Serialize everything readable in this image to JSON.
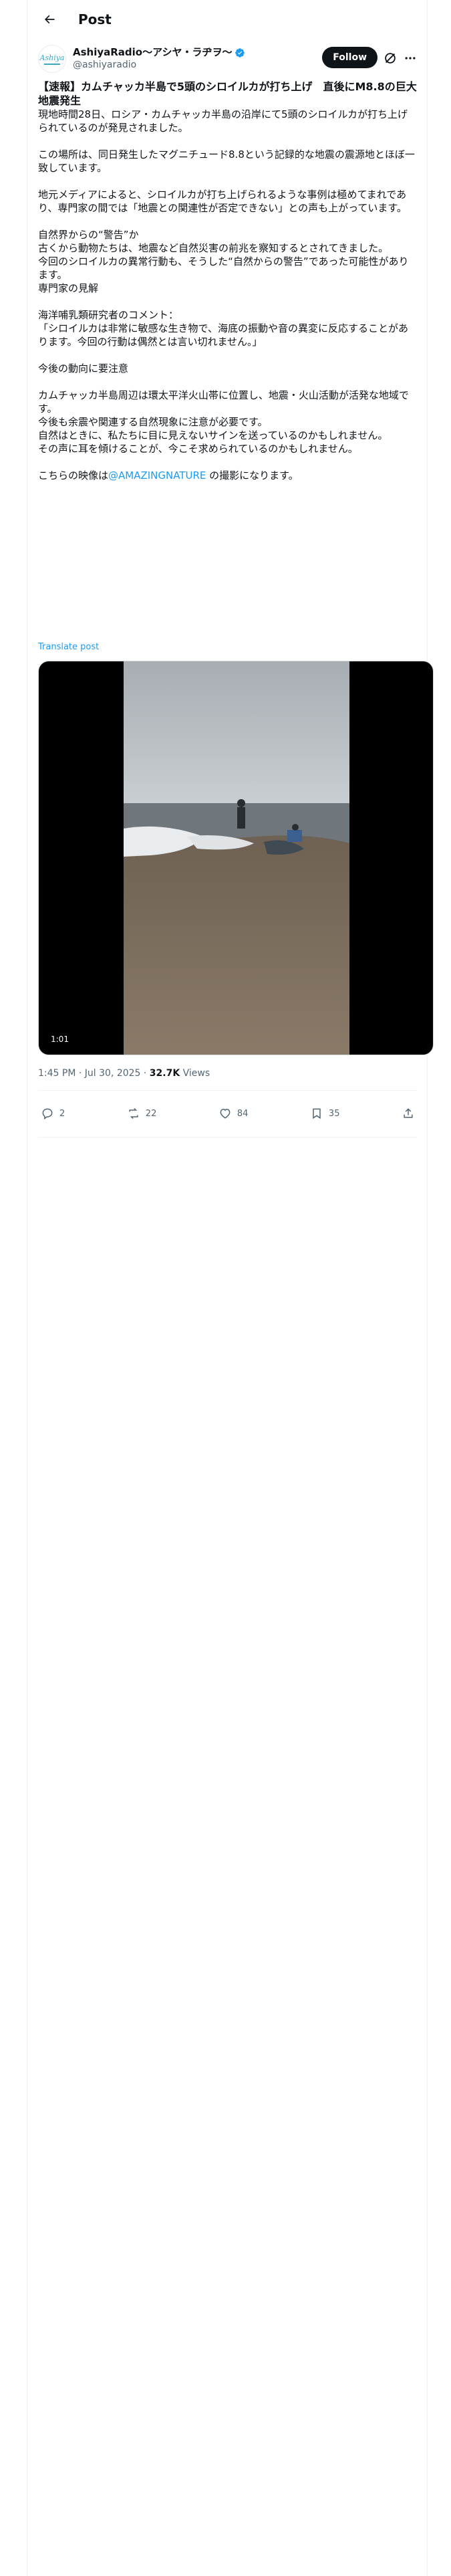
{
  "topbar": {
    "title": "Post"
  },
  "author": {
    "display_name": "AshiyaRadio〜アシヤ・ラヂヲ〜",
    "handle": "@ashiyaradio",
    "avatar_text": "Ashiya",
    "verified": true
  },
  "follow_label": "Follow",
  "post": {
    "headline": "【速報】カムチャッカ半島で5頭のシロイルカが打ち上げ　直後にM8.8の巨大地震発生",
    "body": "現地時間28日、ロシア・カムチャッカ半島の沿岸にて5頭のシロイルカが打ち上げられているのが発見されました。\n\nこの場所は、同日発生したマグニチュード8.8という記録的な地震の震源地とほぼ一致しています。\n\n地元メディアによると、シロイルカが打ち上げられるような事例は極めてまれであり、専門家の間では「地震との関連性が否定できない」との声も上がっています。\n\n自然界からの“警告”か\n古くから動物たちは、地震など自然災害の前兆を察知するとされてきました。\n今回のシロイルカの異常行動も、そうした“自然からの警告”であった可能性があります。\n専門家の見解\n\n海洋哺乳類研究者のコメント：\n「シロイルカは非常に敏感な生き物で、海底の振動や音の異変に反応することがあります。今回の行動は偶然とは言い切れません。」\n\n今後の動向に要注意\n\nカムチャッカ半島周辺は環太平洋火山帯に位置し、地震・火山活動が活発な地域です。\n今後も余震や関連する自然現象に注意が必要です。\n自然はときに、私たちに目に見えないサインを送っているのかもしれません。\nその声に耳を傾けることが、今こそ求められているのかもしれません。\n\nこちらの映像は",
    "mention": "@AMAZINGNATURE",
    "tail": " の撮影になります。",
    "translate_label": "Translate post"
  },
  "media": {
    "duration": "1:01"
  },
  "meta": {
    "time": "1:45 PM · Jul 30, 2025 · ",
    "views": "32.7K",
    "views_label": " Views"
  },
  "actions": {
    "replies": "2",
    "reposts": "22",
    "likes": "84",
    "bookmarks": "35"
  },
  "colors": {
    "accent": "#1d9bf0",
    "text": "#0f1419",
    "muted": "#536471",
    "follow_bg": "#0f1419"
  }
}
